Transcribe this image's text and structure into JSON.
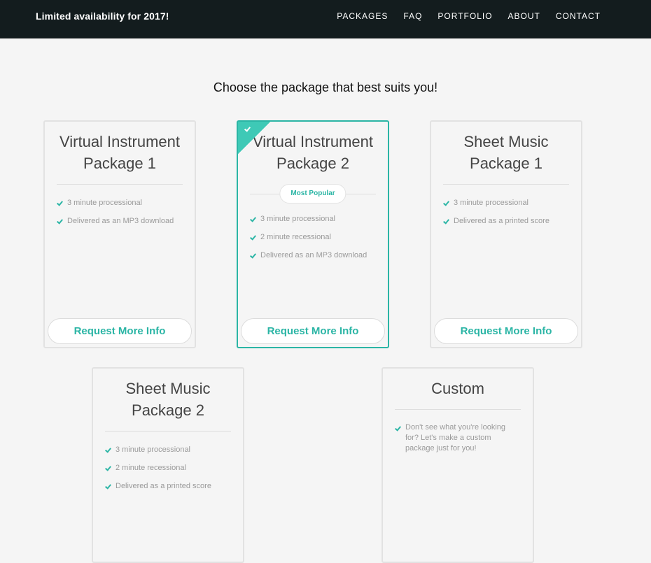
{
  "header": {
    "brand": "Limited availability for 2017!",
    "nav": [
      "PACKAGES",
      "FAQ",
      "PORTFOLIO",
      "ABOUT",
      "CONTACT"
    ]
  },
  "main": {
    "heading": "Choose the package that best suits you!"
  },
  "colors": {
    "accent": "#2bb5a5",
    "topbar": "#131c1e",
    "background": "#f5f5f5"
  },
  "packages": [
    {
      "title_line1": "Virtual Instrument",
      "title_line2": "Package 1",
      "features": [
        "3 minute processional",
        "Delivered as an MP3 download"
      ],
      "cta": "Request More Info"
    },
    {
      "title_line1": "Virtual Instrument",
      "title_line2": "Package 2",
      "badge": "Most Popular",
      "corner_icon": "check-icon",
      "features": [
        "3 minute processional",
        "2 minute recessional",
        "Delivered as an MP3 download"
      ],
      "cta": "Request More Info"
    },
    {
      "title_line1": "Sheet Music",
      "title_line2": "Package 1",
      "features": [
        "3 minute processional",
        "Delivered as a printed score"
      ],
      "cta": "Request More Info"
    },
    {
      "title_line1": "Sheet Music",
      "title_line2": "Package 2",
      "features": [
        "3 minute processional",
        "2 minute recessional",
        "Delivered as a printed score"
      ]
    },
    {
      "title_line1": "Custom",
      "features": [
        "Don't see what you're looking for? Let's make a custom package just for you!"
      ]
    }
  ]
}
